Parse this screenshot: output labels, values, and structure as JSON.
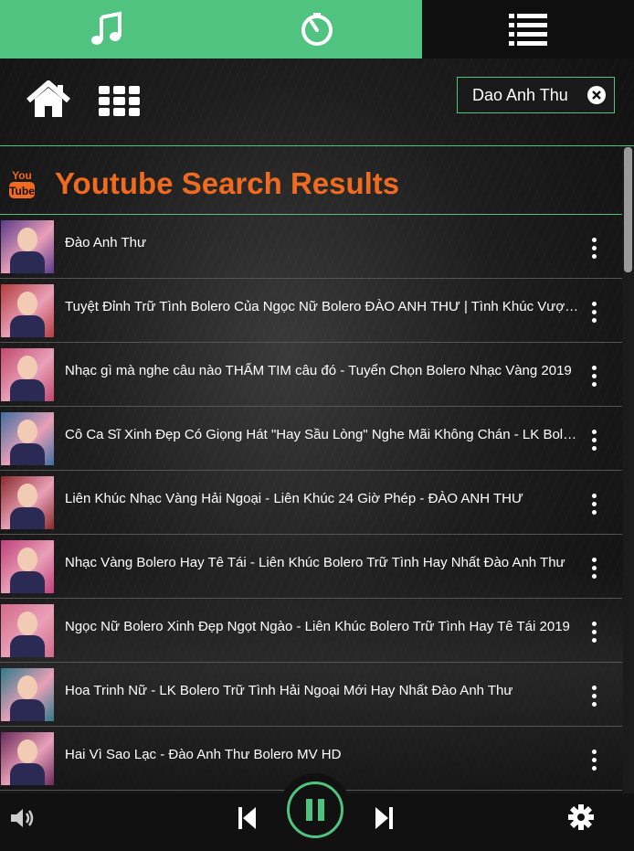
{
  "tabs": [
    {
      "name": "music-note-icon",
      "active": true
    },
    {
      "name": "timer-icon",
      "active": true
    },
    {
      "name": "playlist-icon",
      "active": false
    }
  ],
  "search": {
    "value": "Dao Anh Thu"
  },
  "header": {
    "logo_top": "You",
    "logo_bottom": "Tube",
    "title": "Youtube Search Results"
  },
  "results": [
    {
      "title": "Đào Anh Thư",
      "thumb_color": "#5a3a8a"
    },
    {
      "title": "Tuyệt Đỉnh Trữ Tình Bolero Của Ngọc Nữ Bolero ĐÀO ANH THƯ | Tình Khúc Vượt Thời Gian",
      "thumb_color": "#b43c3c"
    },
    {
      "title": "Nhạc gì mà nghe câu nào THẤM TIM câu đó - Tuyển Chọn Bolero Nhạc Vàng 2019",
      "thumb_color": "#c2486e"
    },
    {
      "title": "Cô Ca Sĩ Xinh Đẹp Có Giọng Hát \"Hay Sầu Lòng\" Nghe Mãi Không Chán - LK Bolero Đào Anh Thư",
      "thumb_color": "#3f6ea0"
    },
    {
      "title": "Liên Khúc Nhạc Vàng Hải Ngoại - Liên Khúc 24 Giờ Phép - ĐÀO ANH THƯ",
      "thumb_color": "#8a2a2a"
    },
    {
      "title": "Nhạc Vàng Bolero Hay Tê Tái - Liên Khúc Bolero Trữ Tình Hay Nhất Đào Anh Thư",
      "thumb_color": "#c0407a"
    },
    {
      "title": "Ngọc Nữ Bolero Xinh Đẹp Ngọt Ngào - Liên Khúc Bolero Trữ Tình Hay Tê Tái 2019",
      "thumb_color": "#d46a8a"
    },
    {
      "title": "Hoa Trinh Nữ - LK Bolero Trữ Tình Hải Ngoại Mới Hay Nhất Đào Anh Thư",
      "thumb_color": "#2e7a8a"
    },
    {
      "title": "Hai Vì Sao Lạc - Đào Anh Thư Bolero MV HD",
      "thumb_color": "#6a2a5a"
    }
  ],
  "player": {
    "state": "playing"
  },
  "colors": {
    "accent": "#4fc37f",
    "title_orange": "#f06b1f"
  }
}
